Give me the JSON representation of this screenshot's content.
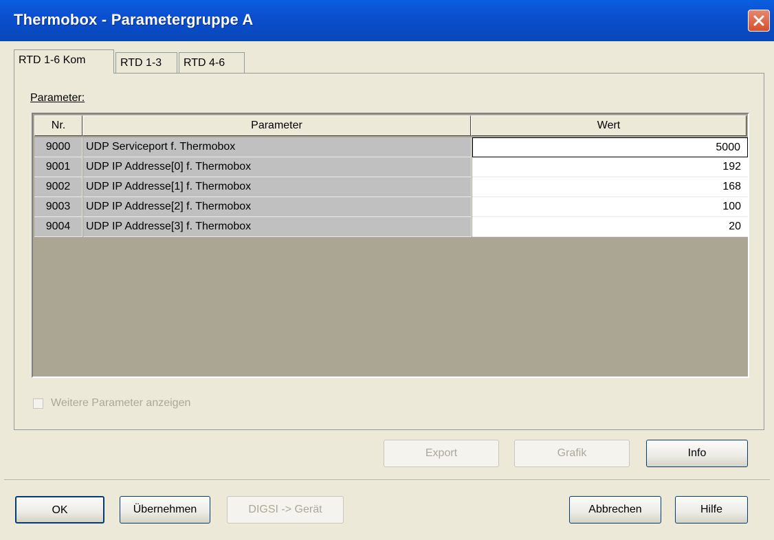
{
  "window": {
    "title": "Thermobox - Parametergruppe A"
  },
  "tabs": [
    {
      "label": "RTD 1-6 Kom",
      "active": true
    },
    {
      "label": "RTD 1-3",
      "active": false
    },
    {
      "label": "RTD 4-6",
      "active": false
    }
  ],
  "params": {
    "label": "Parameter:",
    "headers": {
      "nr": "Nr.",
      "parameter": "Parameter",
      "wert": "Wert"
    },
    "rows": [
      {
        "nr": "9000",
        "parameter": "UDP Serviceport f. Thermobox",
        "wert": "5000"
      },
      {
        "nr": "9001",
        "parameter": "UDP IP Addresse[0] f. Thermobox",
        "wert": "192"
      },
      {
        "nr": "9002",
        "parameter": "UDP IP Addresse[1] f. Thermobox",
        "wert": "168"
      },
      {
        "nr": "9003",
        "parameter": "UDP IP Addresse[2] f. Thermobox",
        "wert": "100"
      },
      {
        "nr": "9004",
        "parameter": "UDP IP Addresse[3] f. Thermobox",
        "wert": "20"
      }
    ]
  },
  "checkbox": {
    "label": "Weitere Parameter anzeigen",
    "checked": false,
    "enabled": false
  },
  "buttons": {
    "export": "Export",
    "grafik": "Grafik",
    "info": "Info",
    "ok": "OK",
    "uebernehmen": "Übernehmen",
    "digsi": "DIGSI -> Gerät",
    "abbrechen": "Abbrechen",
    "hilfe": "Hilfe"
  },
  "colors": {
    "titlebar": "#0b4fd0",
    "dialog_bg": "#ece9d8",
    "grid_bg": "#aba593",
    "close": "#d5502e"
  },
  "icons": {
    "close": "close-icon",
    "checkbox": "checkbox-icon"
  }
}
